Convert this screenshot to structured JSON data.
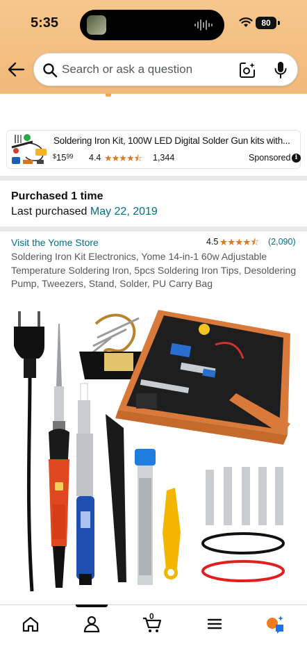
{
  "status": {
    "time": "5:35",
    "battery": "80"
  },
  "search": {
    "placeholder": "Search or ask a question"
  },
  "icons": {
    "back": "back-arrow-icon",
    "search": "search-icon",
    "camera": "camera-icon",
    "mic": "mic-icon",
    "info": "info-icon",
    "home": "home-icon",
    "account": "account-icon",
    "cart": "cart-icon",
    "menu": "menu-icon",
    "ai": "assistant-icon"
  },
  "sponsored_ad": {
    "title": "Soldering Iron Kit, 100W LED Digital Solder Gun kits with...",
    "price_currency": "$",
    "price_whole": "15",
    "price_cents": "99",
    "rating": "4.4",
    "stars": "★★★★⯪",
    "review_count": "1,344",
    "sponsored_label": "Sponsored",
    "info_glyph": "i"
  },
  "purchase_history": {
    "title": "Purchased 1 time",
    "last_label": "Last purchased",
    "last_date": "May 22, 2019"
  },
  "product": {
    "store_link": "Visit the Yome Store",
    "rating": "4.5",
    "stars": "★★★★⯪",
    "review_count": "(2,090)",
    "title": "Soldering Iron Kit Electronics, Yome 14-in-1 60w Adjustable Temperature Soldering Iron, 5pcs Soldering Iron Tips, Desoldering Pump, Tweezers, Stand, Solder, PU Carry Bag"
  },
  "bottom_nav": {
    "cart_count": "0",
    "active_tab": "account"
  },
  "colors": {
    "header_bg": "#f4bf84",
    "link": "#007185",
    "star": "#de7921",
    "text": "#0f1111",
    "muted_text": "#565959",
    "divider": "#e8eaea"
  }
}
